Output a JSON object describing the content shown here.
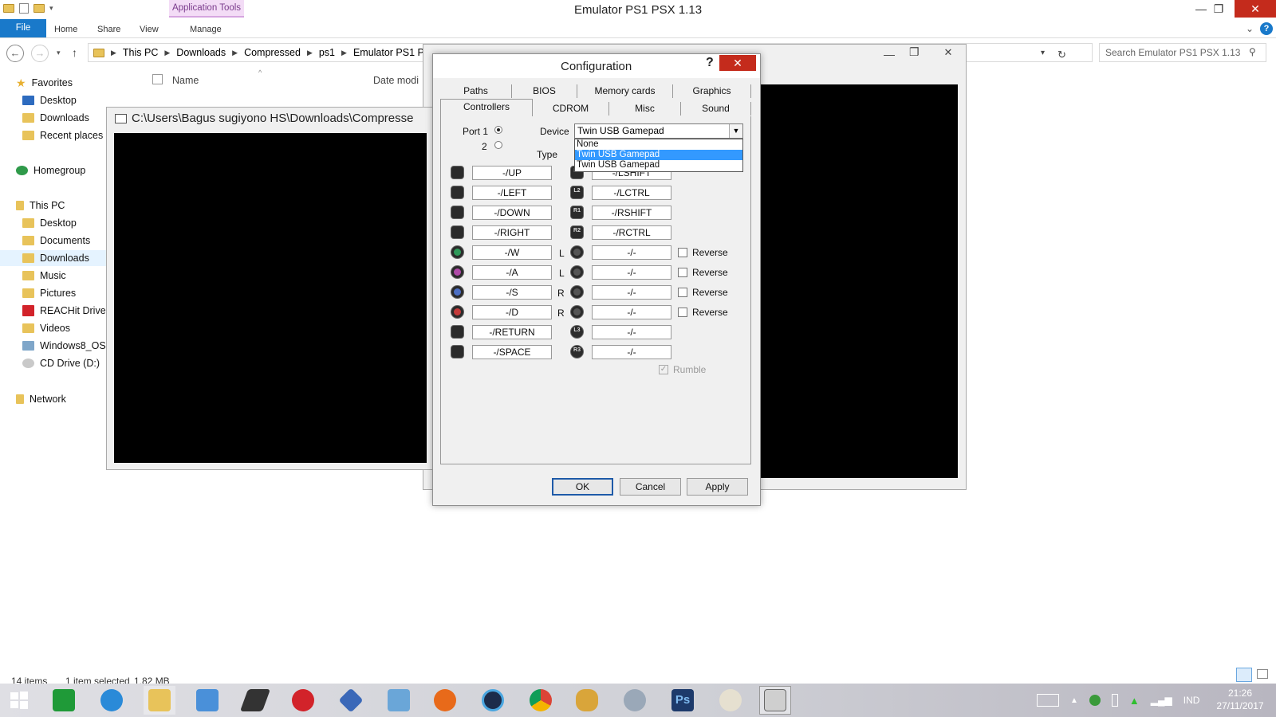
{
  "explorer": {
    "title": "Emulator PS1 PSX 1.13",
    "ribbon_context_tab": "Application Tools",
    "tabs": [
      "File",
      "Home",
      "Share",
      "View",
      "Manage"
    ],
    "breadcrumb": [
      "This PC",
      "Downloads",
      "Compressed",
      "ps1",
      "Emulator PS1 PSX"
    ],
    "search_placeholder": "Search Emulator PS1 PSX 1.13",
    "column_name": "Name",
    "column_date": "Date modi",
    "nav": {
      "favorites": "Favorites",
      "fav_items": [
        "Desktop",
        "Downloads",
        "Recent places"
      ],
      "homegroup": "Homegroup",
      "this_pc": "This PC",
      "pc_items": [
        "Desktop",
        "Documents",
        "Downloads",
        "Music",
        "Pictures",
        "REACHit Drive",
        "Videos",
        "Windows8_OS (",
        "CD Drive (D:)"
      ],
      "network": "Network"
    },
    "status_items": "14 items",
    "status_selected": "1 item selected",
    "status_size": "1,82 MB"
  },
  "console": {
    "title": "C:\\Users\\Bagus sugiyono HS\\Downloads\\Compresse"
  },
  "config": {
    "title": "Configuration",
    "help": "?",
    "tabs_row1": [
      "Paths",
      "BIOS",
      "Memory cards",
      "Graphics"
    ],
    "tabs_row2": [
      "Controllers",
      "CDROM",
      "Misc",
      "Sound"
    ],
    "port_label": "Port 1",
    "port2_label": "2",
    "device_label": "Device",
    "type_label": "Type",
    "device_value": "Twin USB Gamepad",
    "device_options": [
      "None",
      "Twin USB Gamepad",
      "Twin USB Gamepad"
    ],
    "left_keys": [
      "-/UP",
      "-/LEFT",
      "-/DOWN",
      "-/RIGHT",
      "-/W",
      "-/A",
      "-/S",
      "-/D",
      "-/RETURN",
      "-/SPACE"
    ],
    "right_keys": [
      "-/LSHIFT",
      "-/LCTRL",
      "-/RSHIFT",
      "-/RCTRL",
      "-/-",
      "-/-",
      "-/-",
      "-/-",
      "-/-",
      "-/-"
    ],
    "stick_labels": [
      "L",
      "L",
      "R",
      "R"
    ],
    "reverse_label": "Reverse",
    "rumble_label": "Rumble",
    "ok_label": "OK",
    "cancel_label": "Cancel",
    "apply_label": "Apply"
  },
  "tray": {
    "lang": "IND",
    "time": "21:26",
    "date": "27/11/2017"
  },
  "colors": {
    "accent": "#1979ca",
    "close_red": "#c42b1c",
    "highlight": "#3399ff"
  }
}
